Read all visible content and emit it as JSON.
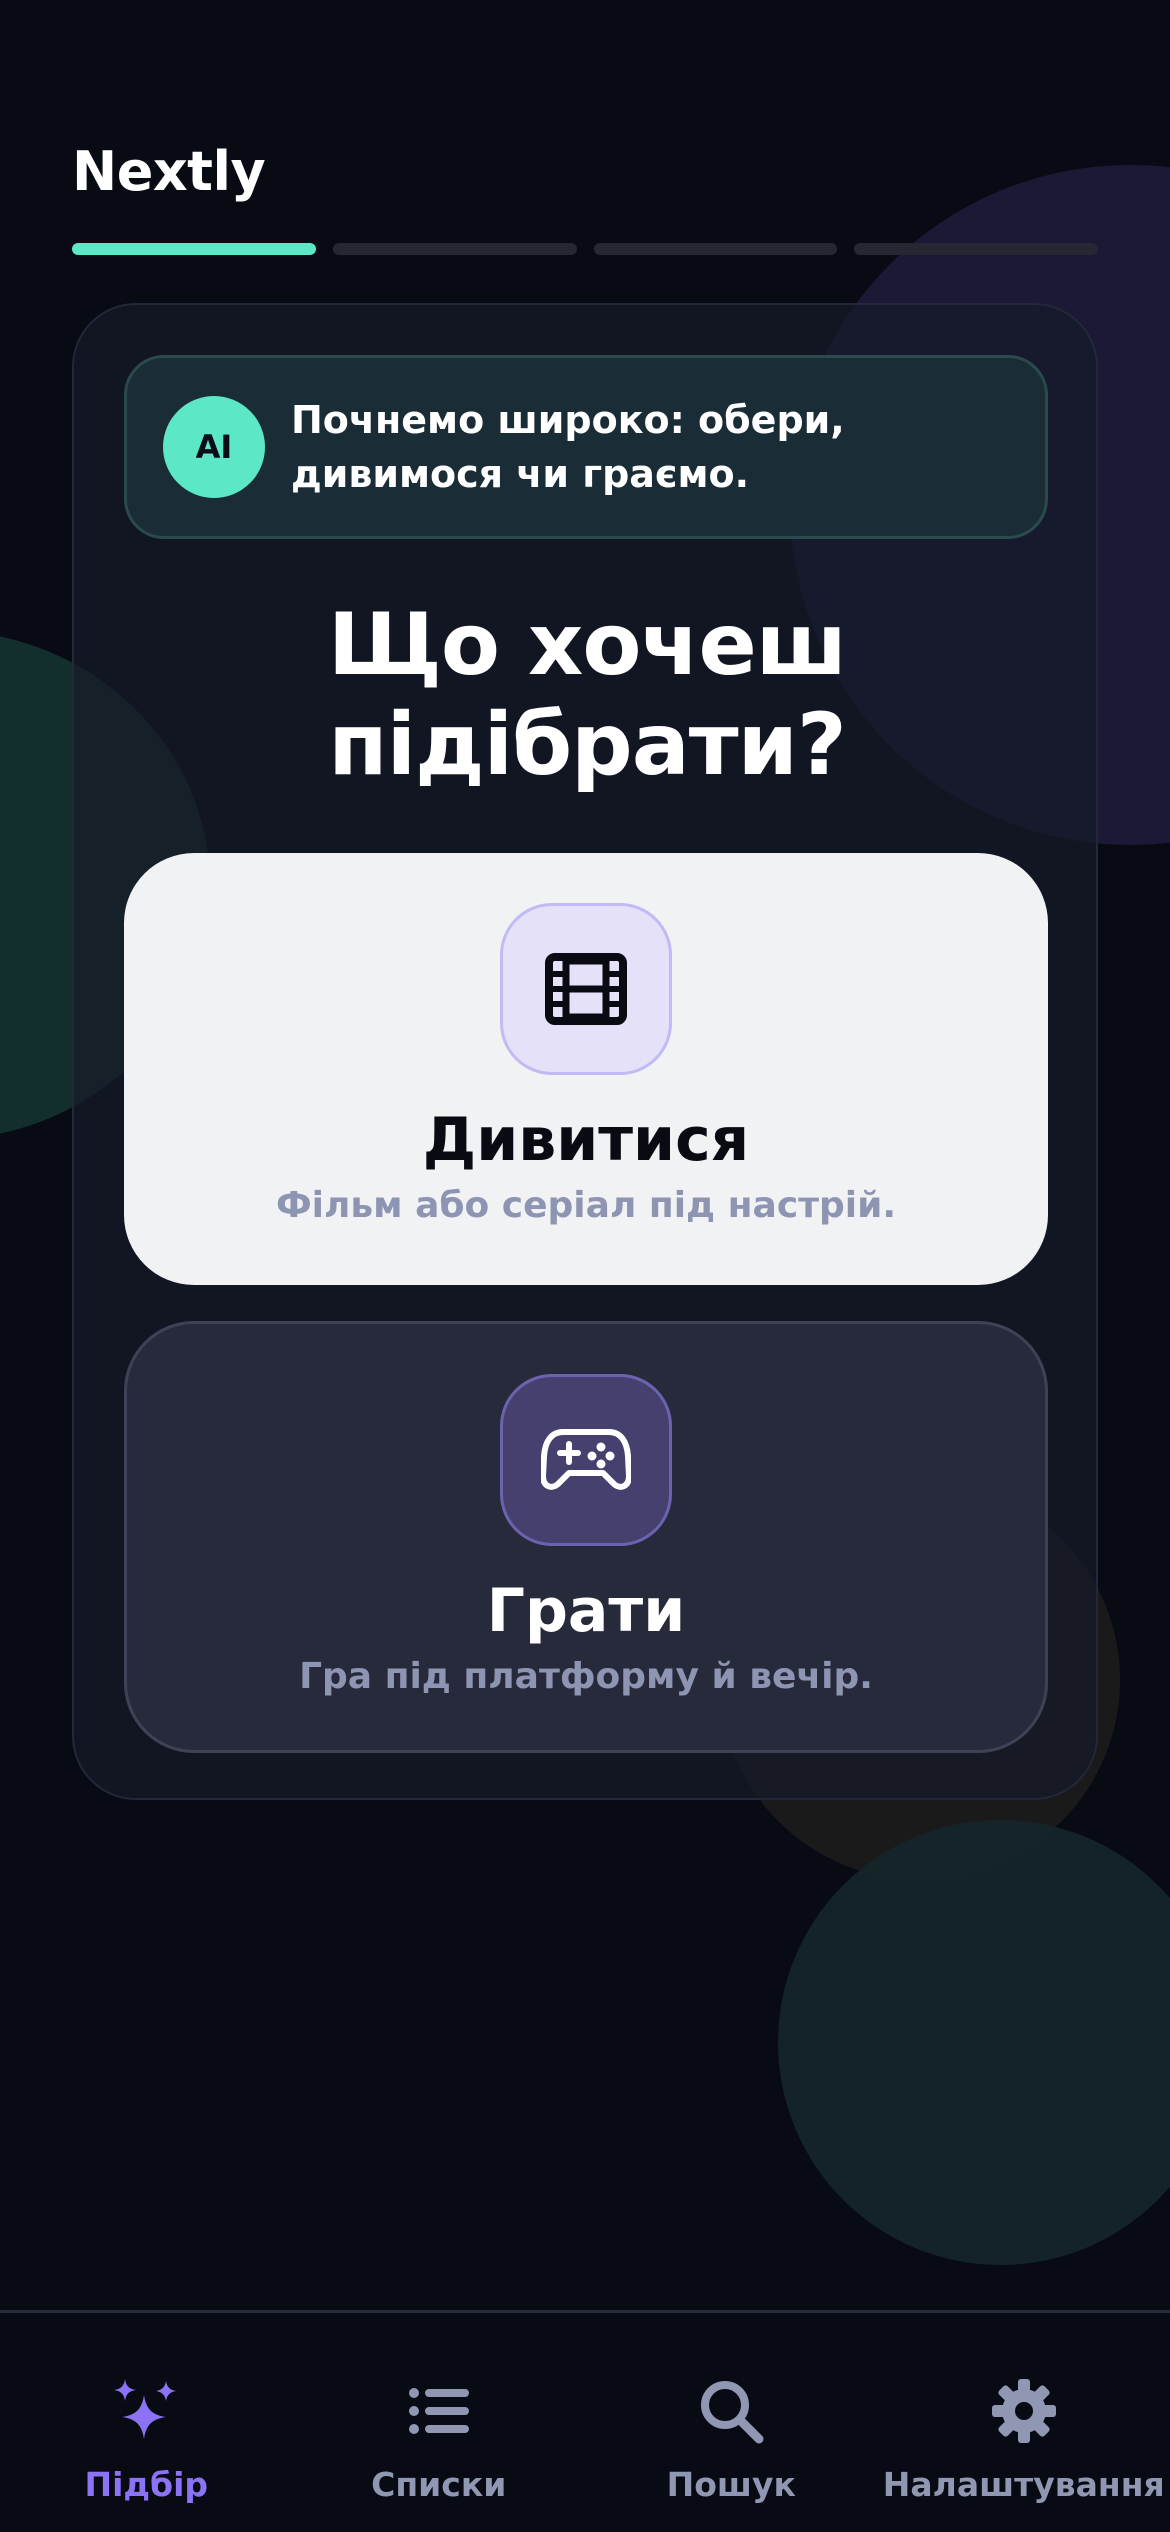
{
  "app": {
    "title": "Nextly"
  },
  "progress": {
    "total": 4,
    "current": 1
  },
  "ai": {
    "avatar_label": "AI",
    "message_line1": "Почнемо широко: обери,",
    "message_line2": "дивимося чи граємо."
  },
  "question": {
    "line1": "Що хочеш",
    "line2": "підібрати?"
  },
  "options": [
    {
      "title": "Дивитися",
      "subtitle": "Фільм або серіал під настрій.",
      "icon": "film-icon",
      "selected": true
    },
    {
      "title": "Грати",
      "subtitle": "Гра під платформу й вечір.",
      "icon": "gamepad-icon",
      "selected": false
    }
  ],
  "nav": {
    "items": [
      {
        "label": "Підбір",
        "icon": "sparkles-icon",
        "active": true
      },
      {
        "label": "Списки",
        "icon": "list-icon",
        "active": false
      },
      {
        "label": "Пошук",
        "icon": "search-icon",
        "active": false
      },
      {
        "label": "Налаштування",
        "icon": "gear-icon",
        "active": false
      }
    ]
  },
  "colors": {
    "background": "#090b14",
    "accent_teal": "#5ce8c6",
    "accent_purple": "#8c73f5",
    "muted_text": "#8d95b3"
  }
}
